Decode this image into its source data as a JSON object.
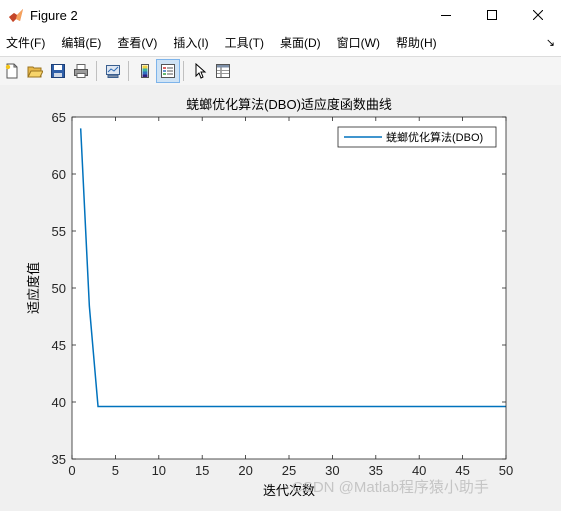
{
  "window": {
    "title": "Figure 2",
    "controls": {
      "minimize": "—",
      "maximize": "☐",
      "close": "✕"
    }
  },
  "menubar": {
    "items": [
      {
        "label": "文件(F)"
      },
      {
        "label": "编辑(E)"
      },
      {
        "label": "查看(V)"
      },
      {
        "label": "插入(I)"
      },
      {
        "label": "工具(T)"
      },
      {
        "label": "桌面(D)"
      },
      {
        "label": "窗口(W)"
      },
      {
        "label": "帮助(H)"
      }
    ],
    "overflow_icon": "↘"
  },
  "toolbar": {
    "buttons": [
      {
        "name": "new-figure-icon"
      },
      {
        "name": "open-file-icon"
      },
      {
        "name": "save-icon"
      },
      {
        "name": "print-icon"
      },
      {
        "name": "link-plot-icon"
      },
      {
        "name": "insert-colorbar-icon"
      },
      {
        "name": "insert-legend-icon",
        "active": true
      },
      {
        "name": "edit-plot-icon"
      },
      {
        "name": "property-inspector-icon"
      }
    ]
  },
  "watermark": "CSDN @Matlab程序猿小助手",
  "chart_data": {
    "type": "line",
    "title": "蜣螂优化算法(DBO)适应度函数曲线",
    "xlabel": "迭代次数",
    "ylabel": "适应度值",
    "xlim": [
      0,
      50
    ],
    "ylim": [
      35,
      65
    ],
    "xticks": [
      0,
      5,
      10,
      15,
      20,
      25,
      30,
      35,
      40,
      45,
      50
    ],
    "yticks": [
      35,
      40,
      45,
      50,
      55,
      60,
      65
    ],
    "grid": false,
    "legend_position": "top-right",
    "colors": {
      "series": "#0072BD",
      "axes": "#262626",
      "plot_bg": "#ffffff"
    },
    "series": [
      {
        "name": "蜣螂优化算法(DBO)",
        "x": [
          1,
          2,
          3,
          4,
          5,
          6,
          7,
          8,
          9,
          10,
          11,
          12,
          13,
          14,
          15,
          16,
          17,
          18,
          19,
          20,
          21,
          22,
          23,
          24,
          25,
          26,
          27,
          28,
          29,
          30,
          31,
          32,
          33,
          34,
          35,
          36,
          37,
          38,
          39,
          40,
          41,
          42,
          43,
          44,
          45,
          46,
          47,
          48,
          49,
          50
        ],
        "values": [
          64.0,
          48.4,
          39.6,
          39.6,
          39.6,
          39.6,
          39.6,
          39.6,
          39.6,
          39.6,
          39.6,
          39.6,
          39.6,
          39.6,
          39.6,
          39.6,
          39.6,
          39.6,
          39.6,
          39.6,
          39.6,
          39.6,
          39.6,
          39.6,
          39.6,
          39.6,
          39.6,
          39.6,
          39.6,
          39.6,
          39.6,
          39.6,
          39.6,
          39.6,
          39.6,
          39.6,
          39.6,
          39.6,
          39.6,
          39.6,
          39.6,
          39.6,
          39.6,
          39.6,
          39.6,
          39.6,
          39.6,
          39.6,
          39.6,
          39.6
        ]
      }
    ]
  }
}
